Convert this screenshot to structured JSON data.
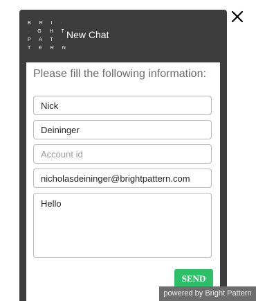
{
  "header": {
    "logo_rows": [
      "BRI·",
      "·GHT",
      "PAT·",
      "TERN"
    ],
    "title": "New Chat"
  },
  "form": {
    "prompt": "Please fill the following information:",
    "first_name": {
      "value": "Nick",
      "placeholder": ""
    },
    "last_name": {
      "value": "Deininger",
      "placeholder": ""
    },
    "account_id": {
      "value": "",
      "placeholder": "Account id"
    },
    "email": {
      "value": "nicholasdeininger@brightpattern.com",
      "placeholder": ""
    },
    "message": {
      "value": "Hello",
      "placeholder": ""
    },
    "send_label": "SEND"
  },
  "footer": {
    "powered_by": "powered by Bright Pattern"
  },
  "icons": {
    "close": "close-icon",
    "logo": "bright-pattern-logo"
  },
  "colors": {
    "header_bg": "#3c3c3c",
    "send_button": "#2ebf6b",
    "logo_accent": "#e44b4b"
  }
}
